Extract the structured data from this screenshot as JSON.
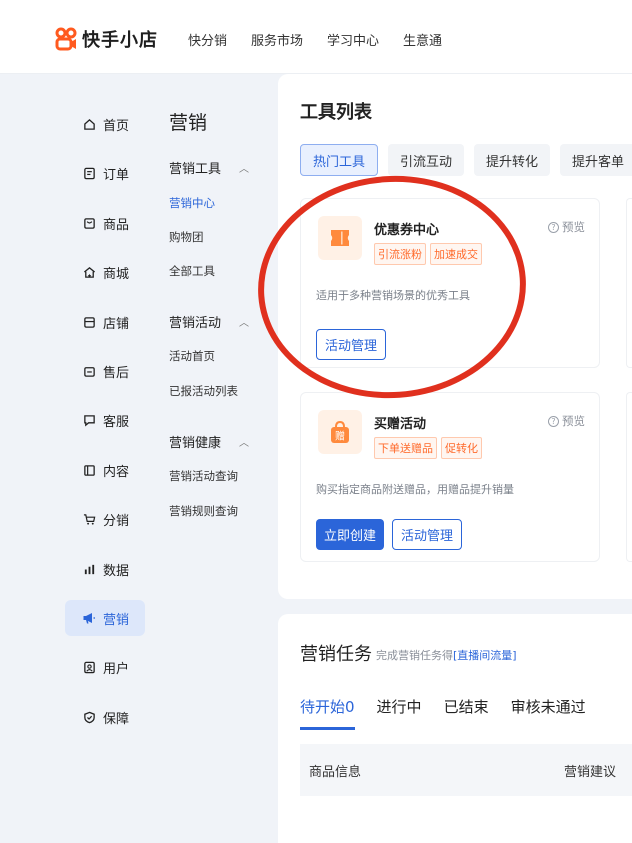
{
  "brand": {
    "name": "快手小店",
    "color": "#ff5a1f"
  },
  "topnav": [
    "快分销",
    "服务市场",
    "学习中心",
    "生意通"
  ],
  "leftnav": [
    {
      "label": "首页",
      "icon": "home-icon"
    },
    {
      "label": "订单",
      "icon": "order-icon"
    },
    {
      "label": "商品",
      "icon": "goods-icon"
    },
    {
      "label": "商城",
      "icon": "mall-icon"
    },
    {
      "label": "店铺",
      "icon": "shop-icon"
    },
    {
      "label": "售后",
      "icon": "aftersale-icon"
    },
    {
      "label": "客服",
      "icon": "service-icon"
    },
    {
      "label": "内容",
      "icon": "content-icon"
    },
    {
      "label": "分销",
      "icon": "distribution-icon"
    },
    {
      "label": "数据",
      "icon": "data-icon"
    },
    {
      "label": "营销",
      "icon": "megaphone-icon",
      "active": true
    },
    {
      "label": "用户",
      "icon": "user-icon"
    },
    {
      "label": "保障",
      "icon": "shield-icon"
    }
  ],
  "subnav": {
    "title": "营销",
    "groups": [
      {
        "label": "营销工具",
        "items": [
          "营销中心",
          "购物团",
          "全部工具"
        ]
      },
      {
        "label": "营销活动",
        "items": [
          "活动首页",
          "已报活动列表"
        ]
      },
      {
        "label": "营销健康",
        "items": [
          "营销活动查询",
          "营销规则查询"
        ]
      }
    ],
    "active_item": "营销中心"
  },
  "tools": {
    "title": "工具列表",
    "tabs": [
      "热门工具",
      "引流互动",
      "提升转化",
      "提升客单"
    ],
    "active_tab": "热门工具",
    "preview_label": "预览",
    "cards": [
      {
        "name": "优惠券中心",
        "tags": [
          "引流涨粉",
          "加速成交"
        ],
        "desc": "适用于多种营销场景的优秀工具",
        "buttons": [
          "活动管理"
        ]
      },
      {
        "name": "买赠活动",
        "tags": [
          "下单送赠品",
          "促转化"
        ],
        "desc": "购买指定商品附送赠品，用赠品提升销量",
        "buttons": [
          "立即创建",
          "活动管理"
        ],
        "icon_text": "赠"
      }
    ]
  },
  "tasks": {
    "title": "营销任务",
    "subtitle_prefix": "完成营销任务得",
    "subtitle_link": "[直播间流量]",
    "tabs": [
      "待开始0",
      "进行中",
      "已结束",
      "审核未通过"
    ],
    "active_tab": "待开始0",
    "columns": [
      "商品信息",
      "营销建议"
    ]
  },
  "colors": {
    "accent": "#2b65d9",
    "tag": "#ff6a2b",
    "annotation": "#e0301e"
  }
}
